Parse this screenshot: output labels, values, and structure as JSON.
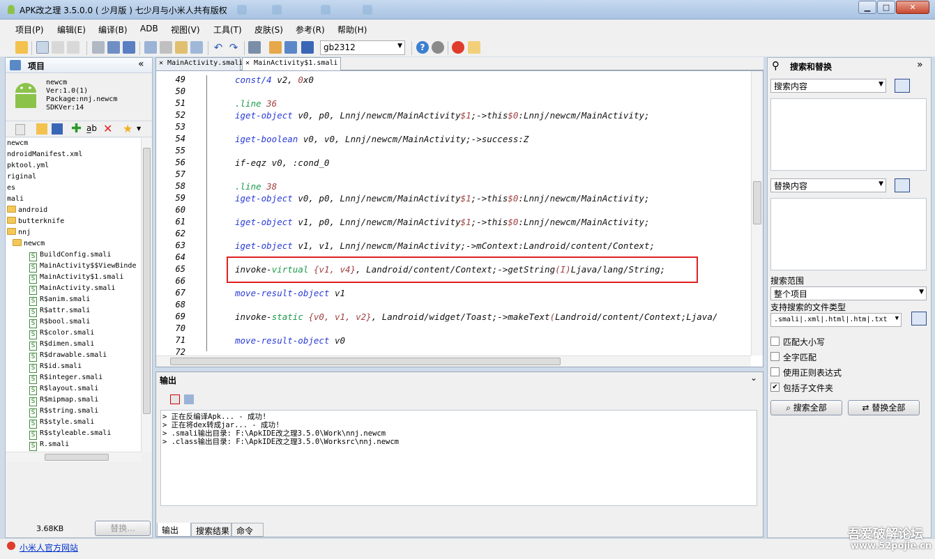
{
  "window": {
    "title": "APK改之理 3.5.0.0 ( 少月版 ) 七少月与小米人共有版权"
  },
  "menu": [
    "项目(P)",
    "编辑(E)",
    "编译(B)",
    "ADB",
    "视图(V)",
    "工具(T)",
    "皮肤(S)",
    "参考(R)",
    "帮助(H)"
  ],
  "toolbar": {
    "encoding": "gb2312"
  },
  "project": {
    "header": "项目",
    "name": "newcm",
    "version": "Ver:1.0(1)",
    "package": "Package:nnj.newcm",
    "sdk": "SDKVer:14",
    "tree": [
      {
        "label": "newcm",
        "type": "plain"
      },
      {
        "label": "ndroidManifest.xml",
        "type": "plain"
      },
      {
        "label": "pktool.yml",
        "type": "plain"
      },
      {
        "label": "riginal",
        "type": "plain"
      },
      {
        "label": "es",
        "type": "plain"
      },
      {
        "label": "mali",
        "type": "plain"
      },
      {
        "label": "android",
        "type": "folder"
      },
      {
        "label": "butterknife",
        "type": "folder"
      },
      {
        "label": "nnj",
        "type": "folder"
      },
      {
        "label": "newcm",
        "type": "folder"
      },
      {
        "label": "BuildConfig.smali",
        "type": "file"
      },
      {
        "label": "MainActivity$$ViewBinde",
        "type": "file"
      },
      {
        "label": "MainActivity$1.smali",
        "type": "file"
      },
      {
        "label": "MainActivity.smali",
        "type": "file"
      },
      {
        "label": "R$anim.smali",
        "type": "file"
      },
      {
        "label": "R$attr.smali",
        "type": "file"
      },
      {
        "label": "R$bool.smali",
        "type": "file"
      },
      {
        "label": "R$color.smali",
        "type": "file"
      },
      {
        "label": "R$dimen.smali",
        "type": "file"
      },
      {
        "label": "R$drawable.smali",
        "type": "file"
      },
      {
        "label": "R$id.smali",
        "type": "file"
      },
      {
        "label": "R$integer.smali",
        "type": "file"
      },
      {
        "label": "R$layout.smali",
        "type": "file"
      },
      {
        "label": "R$mipmap.smali",
        "type": "file"
      },
      {
        "label": "R$string.smali",
        "type": "file"
      },
      {
        "label": "R$style.smali",
        "type": "file"
      },
      {
        "label": "R$styleable.smali",
        "type": "file"
      },
      {
        "label": "R.smali",
        "type": "file"
      }
    ],
    "file_size": "3.68KB",
    "replace_button": "替换..."
  },
  "editor": {
    "tabs": [
      "MainActivity.smali",
      "MainActivity$1.smali"
    ],
    "lines": [
      {
        "n": "49",
        "parts": [
          [
            "kw",
            "const/4 "
          ],
          [
            "reg",
            "v2, "
          ],
          [
            "sym",
            "0"
          ],
          [
            "reg",
            "x0"
          ]
        ]
      },
      {
        "n": "50",
        "parts": []
      },
      {
        "n": "51",
        "parts": [
          [
            "dir",
            ".line "
          ],
          [
            "sym",
            "36"
          ]
        ]
      },
      {
        "n": "52",
        "parts": [
          [
            "kw",
            "iget-object "
          ],
          [
            "reg",
            "v0, p0, Lnnj/newcm/MainActivity"
          ],
          [
            "sym",
            "$1"
          ],
          [
            "reg",
            ";->this"
          ],
          [
            "sym",
            "$0"
          ],
          [
            "reg",
            ":Lnnj/newcm/MainActivity;"
          ]
        ]
      },
      {
        "n": "53",
        "parts": []
      },
      {
        "n": "54",
        "parts": [
          [
            "kw",
            "iget-boolean "
          ],
          [
            "reg",
            "v0, v0, Lnnj/newcm/MainActivity;->success:Z"
          ]
        ]
      },
      {
        "n": "55",
        "parts": []
      },
      {
        "n": "56",
        "parts": [
          [
            "reg",
            "if-eqz v0, :cond_0"
          ]
        ]
      },
      {
        "n": "57",
        "parts": []
      },
      {
        "n": "58",
        "parts": [
          [
            "dir",
            ".line "
          ],
          [
            "sym",
            "38"
          ]
        ]
      },
      {
        "n": "59",
        "parts": [
          [
            "kw",
            "iget-object "
          ],
          [
            "reg",
            "v0, p0, Lnnj/newcm/MainActivity"
          ],
          [
            "sym",
            "$1"
          ],
          [
            "reg",
            ";->this"
          ],
          [
            "sym",
            "$0"
          ],
          [
            "reg",
            ":Lnnj/newcm/MainActivity;"
          ]
        ]
      },
      {
        "n": "60",
        "parts": []
      },
      {
        "n": "61",
        "parts": [
          [
            "kw",
            "iget-object "
          ],
          [
            "reg",
            "v1, p0, Lnnj/newcm/MainActivity"
          ],
          [
            "sym",
            "$1"
          ],
          [
            "reg",
            ";->this"
          ],
          [
            "sym",
            "$0"
          ],
          [
            "reg",
            ":Lnnj/newcm/MainActivity;"
          ]
        ]
      },
      {
        "n": "62",
        "parts": []
      },
      {
        "n": "63",
        "parts": [
          [
            "kw",
            "iget-object "
          ],
          [
            "reg",
            "v1, v1, Lnnj/newcm/MainActivity;->mContext:Landroid/content/Context;"
          ]
        ]
      },
      {
        "n": "64",
        "parts": []
      },
      {
        "n": "65",
        "parts": [
          [
            "reg",
            "invoke-"
          ],
          [
            "dir",
            "virtual "
          ],
          [
            "sym",
            "{v1, v4}"
          ],
          [
            "reg",
            ", Landroid/content/Context;->getString"
          ],
          [
            "sym",
            "(I)"
          ],
          [
            "reg",
            "Ljava/lang/String;"
          ]
        ]
      },
      {
        "n": "66",
        "parts": []
      },
      {
        "n": "67",
        "parts": [
          [
            "kw",
            "move-result-object "
          ],
          [
            "reg",
            "v1"
          ]
        ]
      },
      {
        "n": "68",
        "parts": []
      },
      {
        "n": "69",
        "parts": [
          [
            "reg",
            "invoke-"
          ],
          [
            "dir",
            "static "
          ],
          [
            "sym",
            "{v0, v1, v2}"
          ],
          [
            "reg",
            ", Landroid/widget/Toast;->makeText"
          ],
          [
            "sym",
            "("
          ],
          [
            "reg",
            "Landroid/content/Context;Ljava/"
          ]
        ]
      },
      {
        "n": "70",
        "parts": []
      },
      {
        "n": "71",
        "parts": [
          [
            "kw",
            "move-result-object "
          ],
          [
            "reg",
            "v0"
          ]
        ]
      },
      {
        "n": "72",
        "parts": []
      }
    ]
  },
  "output": {
    "header": "输出",
    "lines": [
      "> 正在反编译Apk...  - 成功!",
      "> 正在将dex转成jar...  - 成功!",
      "> .smali输出目录: F:\\ApkIDE改之理3.5.0\\Work\\nnj.newcm",
      "> .class输出目录: F:\\ApkIDE改之理3.5.0\\Worksrc\\nnj.newcm"
    ],
    "tabs": [
      "输出",
      "搜索结果",
      "命令"
    ]
  },
  "search": {
    "header": "搜索和替换",
    "search_placeholder": "搜索内容",
    "replace_placeholder": "替换内容",
    "scope_label": "搜索范围",
    "scope_value": "整个项目",
    "filetypes_label": "支持搜索的文件类型",
    "filetypes_value": ".smali|.xml|.html|.htm|.txt",
    "options": [
      {
        "label": "匹配大小写",
        "checked": false
      },
      {
        "label": "全字匹配",
        "checked": false
      },
      {
        "label": "使用正则表达式",
        "checked": false
      },
      {
        "label": "包括子文件夹",
        "checked": true
      }
    ],
    "search_all": "搜索全部",
    "replace_all": "替换全部"
  },
  "status": {
    "link": "小米人官方网站"
  },
  "watermark": {
    "line1": "吾爱破解论坛",
    "line2": "www.52pojie.cn"
  }
}
